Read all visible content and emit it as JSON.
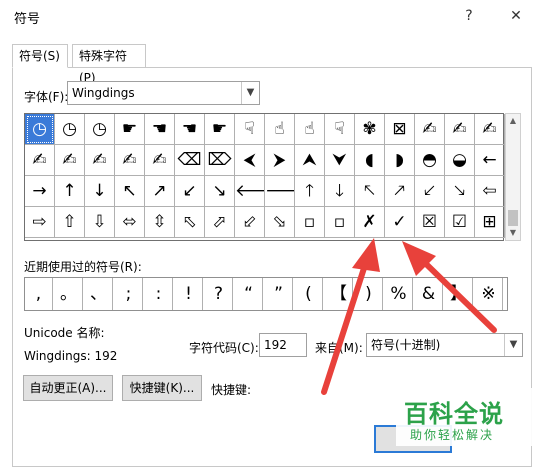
{
  "window": {
    "title": "符号",
    "help_glyph": "?",
    "close_glyph": "✕"
  },
  "tabs": [
    {
      "label": "符号(S)",
      "active": true
    },
    {
      "label": "特殊字符(P)",
      "active": false
    }
  ],
  "font": {
    "label": "字体(F):",
    "value": "Wingdings"
  },
  "symbol_grid": {
    "rows": [
      [
        "◷",
        "◷",
        "◷",
        "☛",
        "☚",
        "☚",
        "☛",
        "☟",
        "☝",
        "☝",
        "☟",
        "✾",
        "⊠",
        "✍",
        "✍",
        "✍"
      ],
      [
        "✍",
        "✍",
        "✍",
        "✍",
        "✍",
        "⌫",
        "⌦",
        "⮜",
        "⮞",
        "⮝",
        "⮟",
        "◖",
        "◗",
        "◓",
        "◒",
        "←"
      ],
      [
        "→",
        "↑",
        "↓",
        "↖",
        "↗",
        "↙",
        "↘",
        "🡐",
        "🡒",
        "🡑",
        "🡓",
        "🡔",
        "🡕",
        "🡗",
        "🡖",
        "⇦"
      ],
      [
        "⇨",
        "⇧",
        "⇩",
        "⬄",
        "⇳",
        "⬁",
        "⬀",
        "⬃",
        "⬂",
        "▫",
        "▫",
        "✗",
        "✓",
        "☒",
        "☑",
        "⊞"
      ]
    ],
    "selected": {
      "row": 0,
      "col": 0
    }
  },
  "recent": {
    "label": "近期使用过的符号(R):",
    "symbols": [
      ",",
      "。",
      "、",
      ";",
      ":",
      "!",
      "?",
      "“",
      "”",
      "(",
      "【",
      ")",
      "%",
      "&",
      "】",
      "※"
    ]
  },
  "unicode_name_label": "Unicode 名称:",
  "char_name": "Wingdings: 192",
  "char_code": {
    "label": "字符代码(C):",
    "value": "192"
  },
  "from": {
    "label": "来自(M):",
    "value": "符号(十进制)"
  },
  "buttons": {
    "autocorrect": "自动更正(A)...",
    "shortcut_key": "快捷键(K)...",
    "shortcut_label": "快捷键:"
  },
  "watermark": {
    "line1": "百科全说",
    "line2": "助你轻松解决"
  },
  "colors": {
    "selection": "#3a7ad8",
    "annotation_arrow": "#e8413b",
    "watermark": "#2ca24a"
  }
}
